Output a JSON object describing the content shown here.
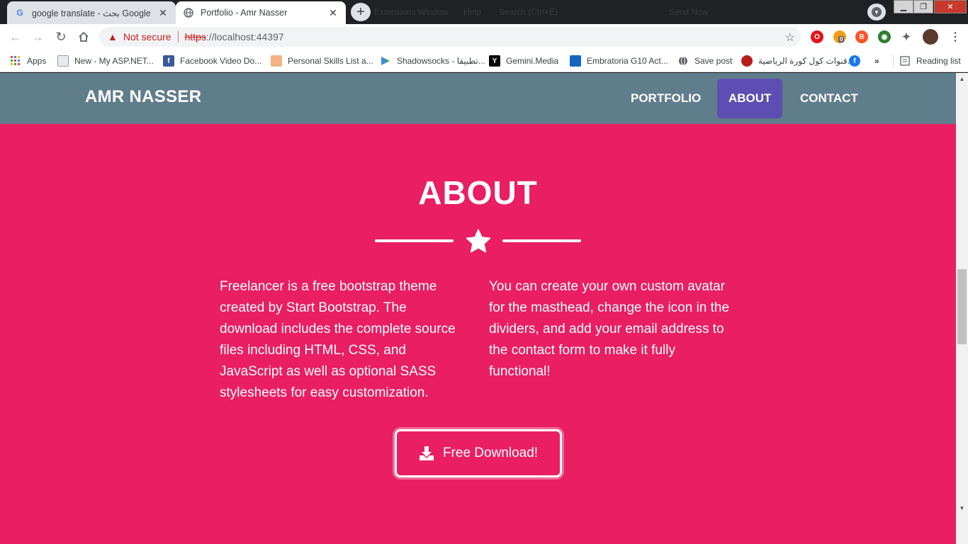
{
  "browser": {
    "tabs": [
      {
        "title": "google translate - بحث Google",
        "favicon": "google-icon",
        "active": false
      },
      {
        "title": "Portfolio - Amr Nasser",
        "favicon": "globe-icon",
        "active": true
      }
    ],
    "background_menu": [
      "Extensions",
      "Window",
      "Help",
      "Search (Ctrl+E)",
      "Send Now"
    ],
    "omnibox": {
      "security_label": "Not secure",
      "url_scheme": "https",
      "url_rest": "://localhost:44397"
    },
    "extension_badge": "0",
    "bookmarks": [
      {
        "label": "Apps",
        "icon": "apps-grid-icon"
      },
      {
        "label": "New - My ASP.NET...",
        "icon": "page-icon"
      },
      {
        "label": "Facebook Video Do...",
        "icon": "facebook-square-icon"
      },
      {
        "label": "Personal Skills List a...",
        "icon": "skills-icon"
      },
      {
        "label": "Shadowsocks - تطبيقا...",
        "icon": "play-store-icon"
      },
      {
        "label": "Gemini.Media",
        "icon": "y-icon"
      },
      {
        "label": "Embratoria G10 Act...",
        "icon": "embratoria-icon"
      },
      {
        "label": "Save post",
        "icon": "globe-icon"
      },
      {
        "label": "قنوات كول كورة الرياضية...",
        "icon": "sports-icon"
      },
      {
        "label": "",
        "icon": "facebook-icon"
      }
    ],
    "overflow_label": "»",
    "reading_list": "Reading list"
  },
  "site": {
    "brand": "AMR NASSER",
    "nav": [
      {
        "label": "PORTFOLIO",
        "active": false
      },
      {
        "label": "ABOUT",
        "active": true
      },
      {
        "label": "CONTACT",
        "active": false
      }
    ],
    "about": {
      "title": "ABOUT",
      "col1": "Freelancer is a free bootstrap theme created by Start Bootstrap. The download includes the complete source files including HTML, CSS, and JavaScript as well as optional SASS stylesheets for easy customization.",
      "col2": "You can create your own custom avatar for the masthead, change the icon in the dividers, and add your email address to the contact form to make it fully functional!",
      "button": "Free Download!"
    },
    "colors": {
      "nav_bg": "#607d8b",
      "section_bg": "#e91e63",
      "active_nav": "#5e4db2"
    }
  }
}
